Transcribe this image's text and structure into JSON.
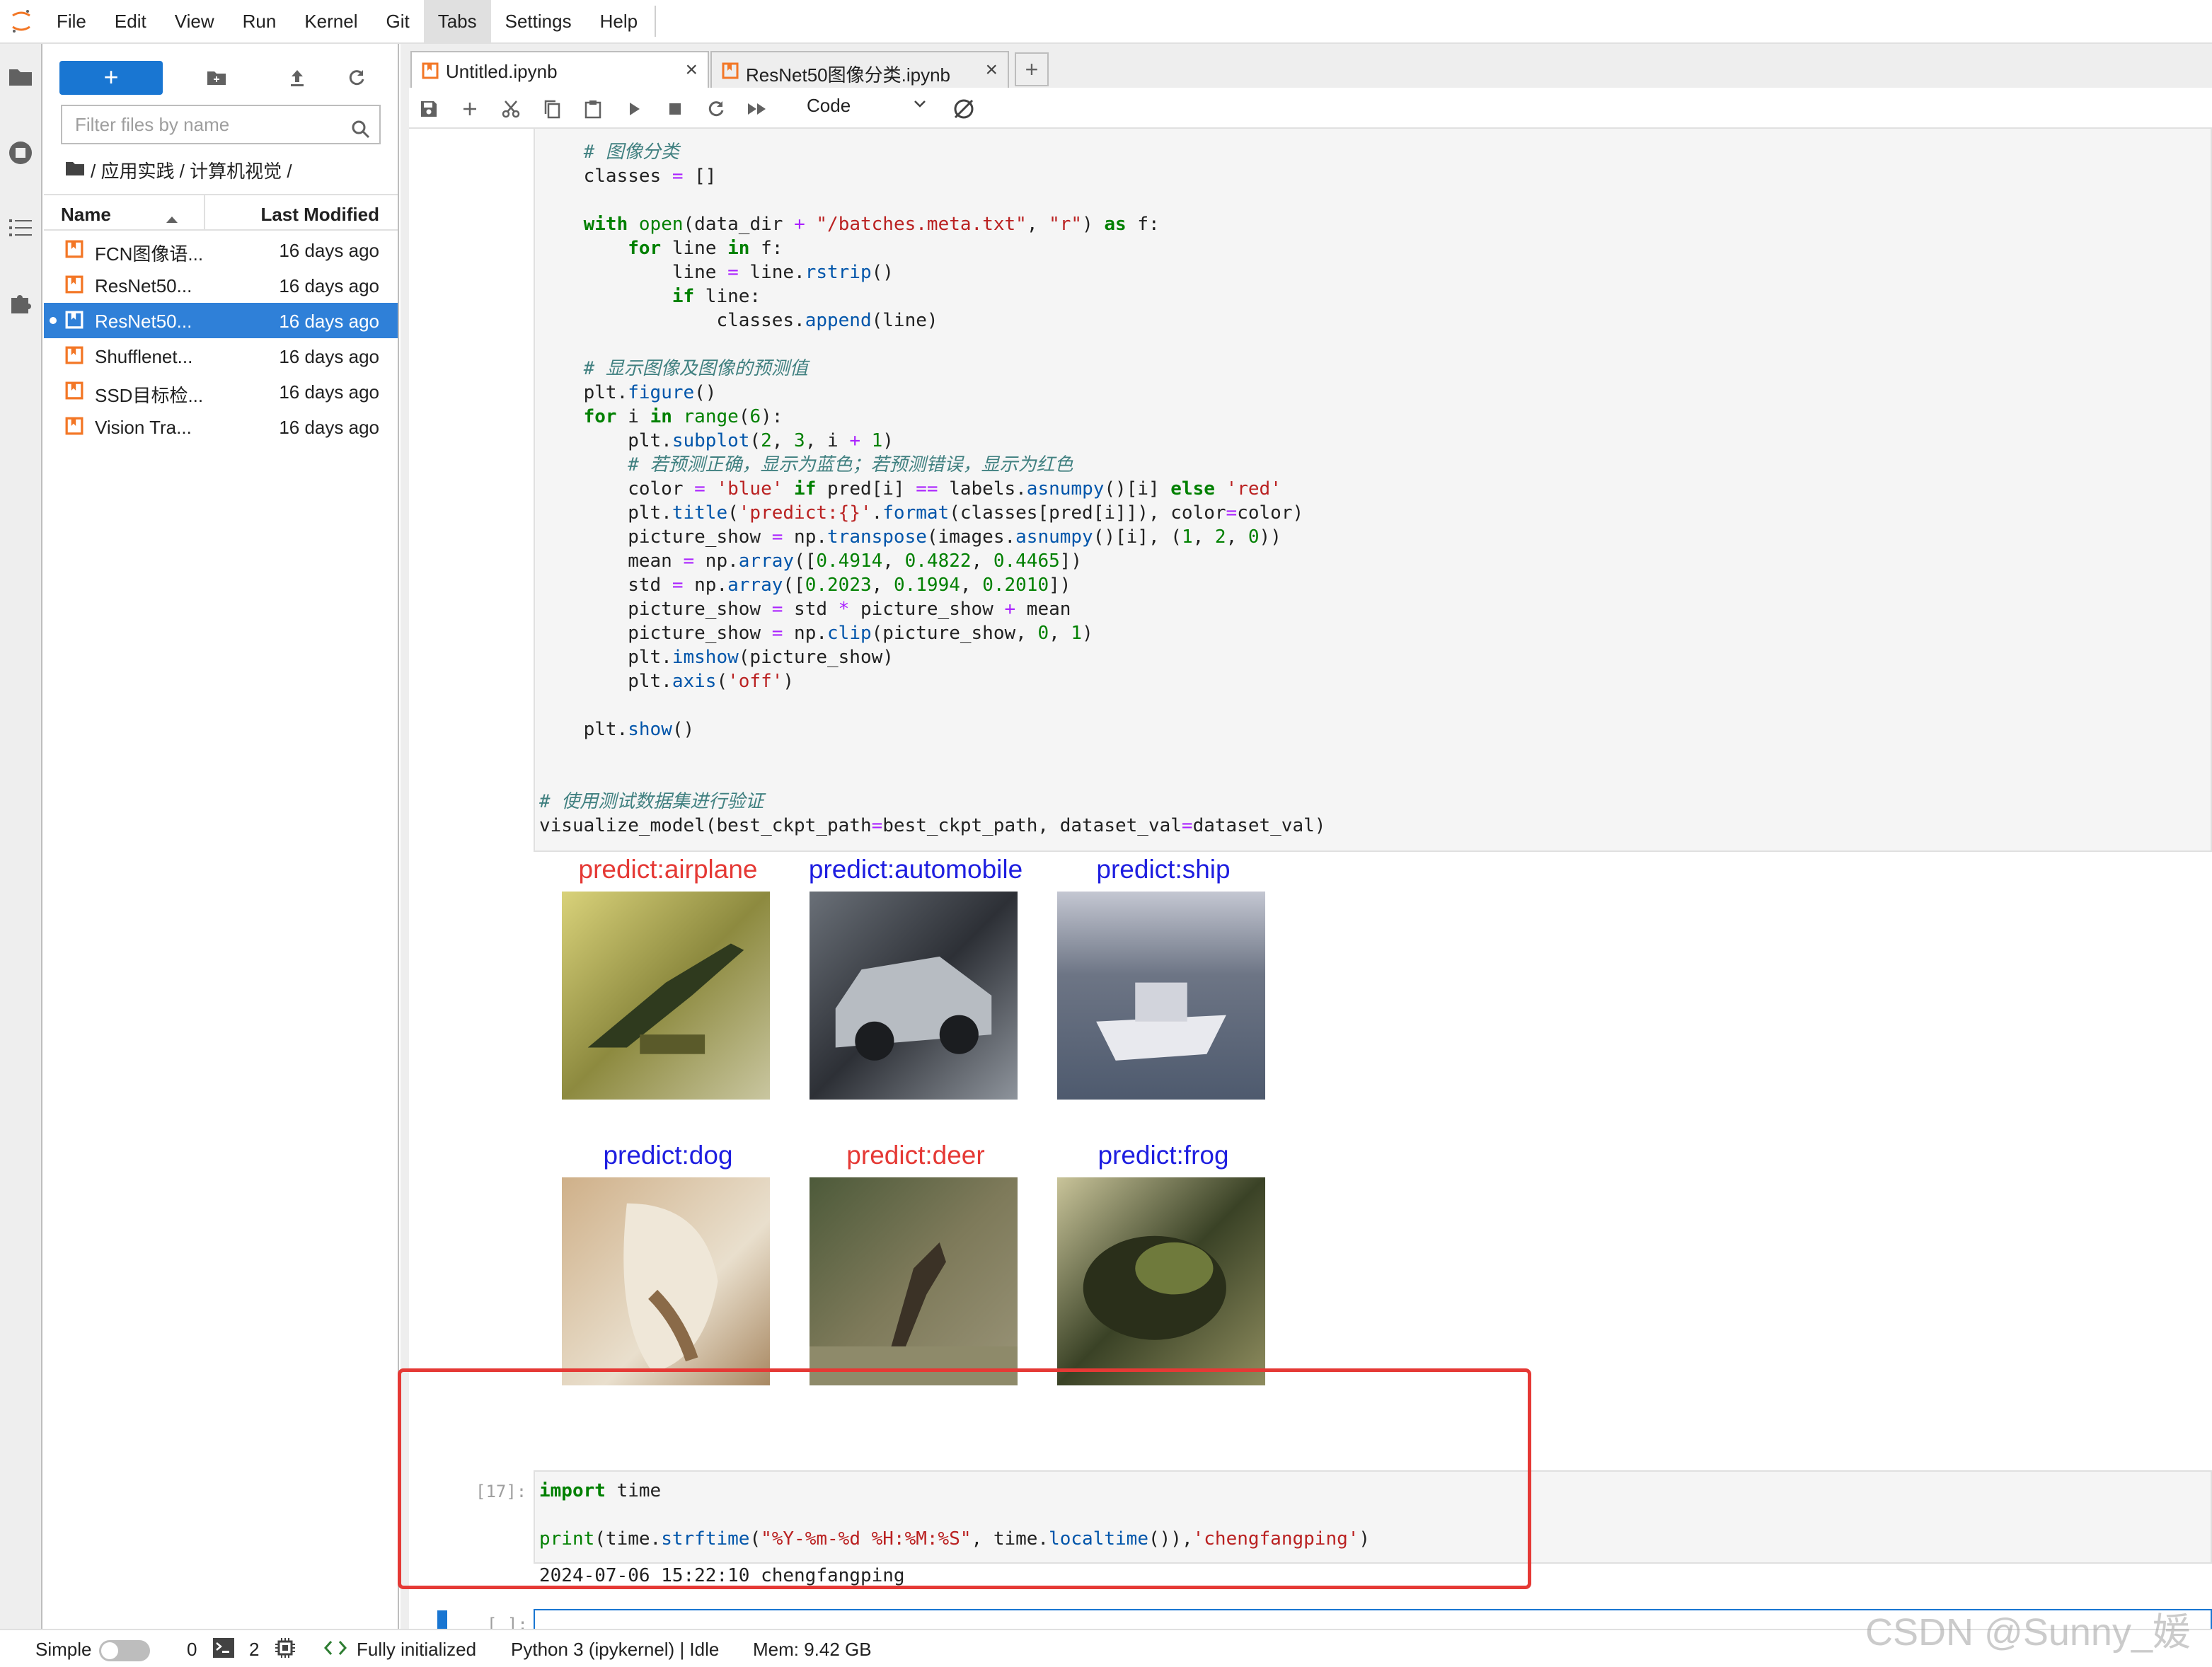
{
  "menu": [
    "File",
    "Edit",
    "View",
    "Run",
    "Kernel",
    "Git",
    "Tabs",
    "Settings",
    "Help"
  ],
  "menu_active": "Tabs",
  "filebrowser": {
    "new_label": "+",
    "filter_placeholder": "Filter files by name",
    "breadcrumb": "/ 应用实践 / 计算机视觉 /",
    "col_name": "Name",
    "col_modified": "Last Modified",
    "files": [
      {
        "name": "FCN图像语...",
        "modified": "16 days ago",
        "selected": false
      },
      {
        "name": "ResNet50...",
        "modified": "16 days ago",
        "selected": false
      },
      {
        "name": "ResNet50...",
        "modified": "16 days ago",
        "selected": true
      },
      {
        "name": "Shufflenet...",
        "modified": "16 days ago",
        "selected": false
      },
      {
        "name": "SSD目标检...",
        "modified": "16 days ago",
        "selected": false
      },
      {
        "name": "Vision Tra...",
        "modified": "16 days ago",
        "selected": false
      }
    ]
  },
  "tabs": [
    {
      "label": "Untitled.ipynb",
      "active": true
    },
    {
      "label": "ResNet50图像分类.ipynb",
      "active": false
    }
  ],
  "toolbar": {
    "cell_type": "Code"
  },
  "code_cell": [
    "    # 图像分类",
    "    classes = []",
    "",
    "    with open(data_dir + \"/batches.meta.txt\", \"r\") as f:",
    "        for line in f:",
    "            line = line.rstrip()",
    "            if line:",
    "                classes.append(line)",
    "",
    "    # 显示图像及图像的预测值",
    "    plt.figure()",
    "    for i in range(6):",
    "        plt.subplot(2, 3, i + 1)",
    "        # 若预测正确，显示为蓝色；若预测错误，显示为红色",
    "        color = 'blue' if pred[i] == labels.asnumpy()[i] else 'red'",
    "        plt.title('predict:{}'.format(classes[pred[i]]), color=color)",
    "        picture_show = np.transpose(images.asnumpy()[i], (1, 2, 0))",
    "        mean = np.array([0.4914, 0.4822, 0.4465])",
    "        std = np.array([0.2023, 0.1994, 0.2010])",
    "        picture_show = std * picture_show + mean",
    "        picture_show = np.clip(picture_show, 0, 1)",
    "        plt.imshow(picture_show)",
    "        plt.axis('off')",
    "",
    "    plt.show()",
    "",
    "",
    "# 使用测试数据集进行验证",
    "visualize_model(best_ckpt_path=best_ckpt_path, dataset_val=dataset_val)"
  ],
  "predictions": [
    {
      "title": "predict:airplane",
      "color": "#e53935"
    },
    {
      "title": "predict:automobile",
      "color": "#1e1ee0"
    },
    {
      "title": "predict:ship",
      "color": "#1e1ee0"
    },
    {
      "title": "predict:dog",
      "color": "#1e1ee0"
    },
    {
      "title": "predict:deer",
      "color": "#e53935"
    },
    {
      "title": "predict:frog",
      "color": "#1e1ee0"
    }
  ],
  "cell17": {
    "prompt": "[17]:",
    "line1": "import time",
    "line2": "print(time.strftime(\"%Y-%m-%d %H:%M:%S\", time.localtime()),'chengfangping')",
    "output": "2024-07-06 15:22:10 chengfangping"
  },
  "empty_cell_prompt": "[ ]:",
  "status": {
    "mode": "Simple",
    "terminals": "0",
    "kernels": "2",
    "lsp": "Fully initialized",
    "kernel": "Python 3 (ipykernel) | Idle",
    "mem": "Mem: 9.42 GB"
  },
  "watermark": "CSDN @Sunny_媛"
}
